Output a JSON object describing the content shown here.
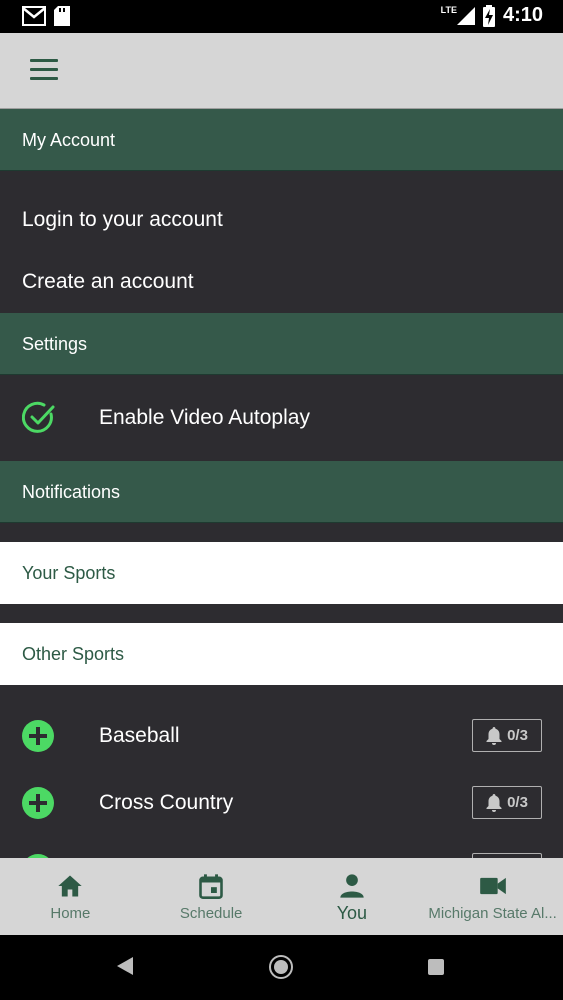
{
  "status_bar": {
    "time": "4:10",
    "network": "LTE"
  },
  "account": {
    "header": "My Account",
    "login": "Login to your account",
    "create": "Create an account"
  },
  "settings": {
    "header": "Settings",
    "autoplay_label": "Enable Video Autoplay"
  },
  "notifications": {
    "header": "Notifications",
    "your_sports": "Your Sports",
    "other_sports": "Other Sports",
    "sports": [
      {
        "name": "Baseball",
        "count": "0/3"
      },
      {
        "name": "Cross Country",
        "count": "0/3"
      }
    ]
  },
  "bottom_nav": [
    {
      "label": "Home",
      "icon": "home-icon"
    },
    {
      "label": "Schedule",
      "icon": "calendar-icon"
    },
    {
      "label": "You",
      "icon": "person-icon",
      "active": true
    },
    {
      "label": "Michigan State Al...",
      "icon": "video-camera-icon"
    }
  ],
  "colors": {
    "accent_green": "#35594a",
    "icon_green": "#2d5a45",
    "bright_green": "#4cd964",
    "dark_bg": "#2d2c30"
  }
}
